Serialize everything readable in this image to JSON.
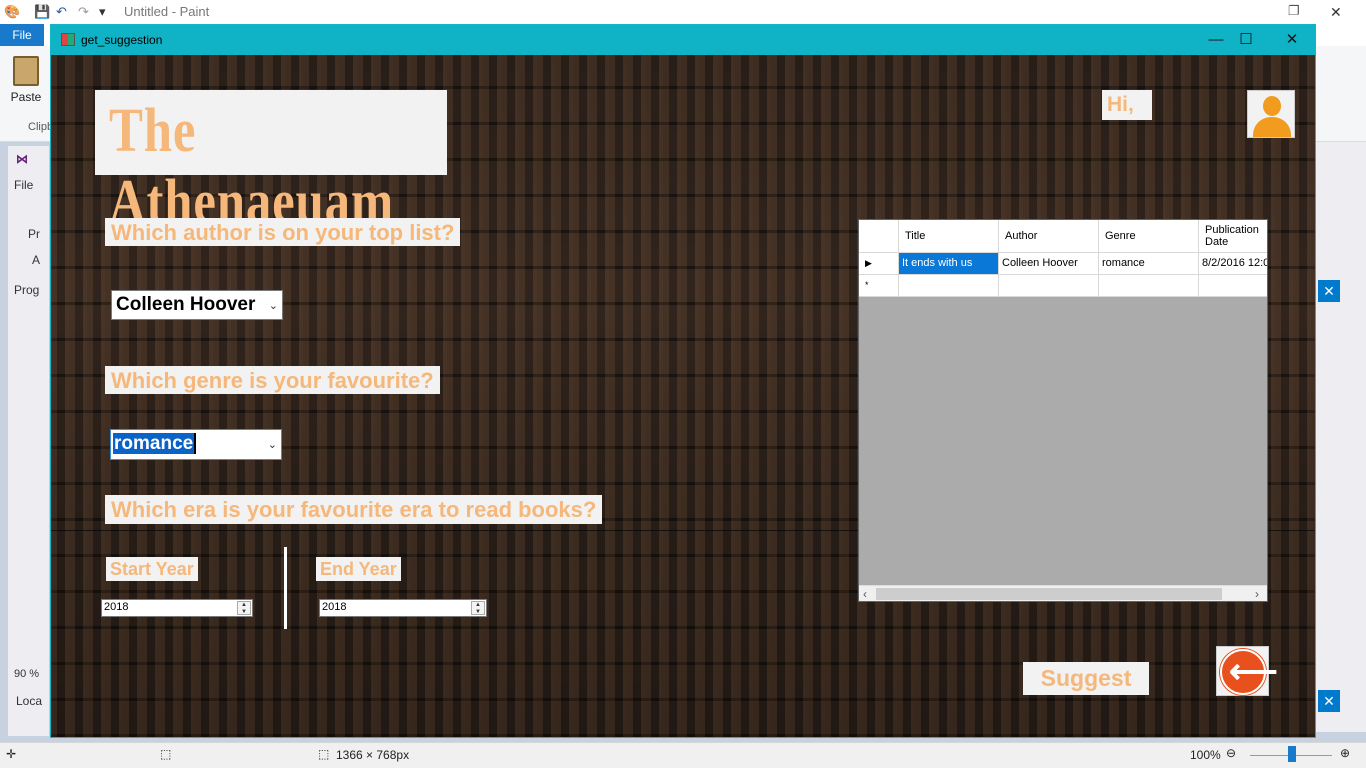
{
  "paint": {
    "title": "Untitled - Paint",
    "file_tab": "File",
    "paste_label": "Paste",
    "clipboard_label": "Clipb",
    "status_size": "1366 × 768px",
    "zoom": "100%"
  },
  "vs": {
    "file": "File",
    "pr": "Pr",
    "a": "A",
    "prog": "Prog",
    "zoom": "90 %",
    "loca": "Loca"
  },
  "window": {
    "title": "get_suggestion",
    "minimize": "—",
    "maximize": "☐",
    "close": "✕"
  },
  "header": {
    "app_name": "The Athenaeuam",
    "greeting": "Hi,"
  },
  "form": {
    "author_question": "Which author is on your top list?",
    "author_value": "Colleen Hoover",
    "genre_question": "Which genre is your favourite?",
    "genre_value": "romance",
    "era_question": "Which era is your favourite era to read books?",
    "start_year_label": "Start Year",
    "start_year_value": "2018",
    "end_year_label": "End Year",
    "end_year_value": "2018"
  },
  "grid": {
    "columns": [
      "Title",
      "Author",
      "Genre",
      "Publication Date"
    ],
    "rows": [
      [
        "It ends with us",
        "Colleen Hoover",
        "romance",
        "8/2/2016 12:0"
      ]
    ],
    "new_row_marker": "*",
    "current_row_marker": "▶"
  },
  "actions": {
    "suggest_label": "Suggest"
  },
  "colors": {
    "accent_text": "#f5b77a",
    "titlebar": "#0fb3c5",
    "selection": "#0a78d7",
    "back_button": "#e8501d"
  }
}
